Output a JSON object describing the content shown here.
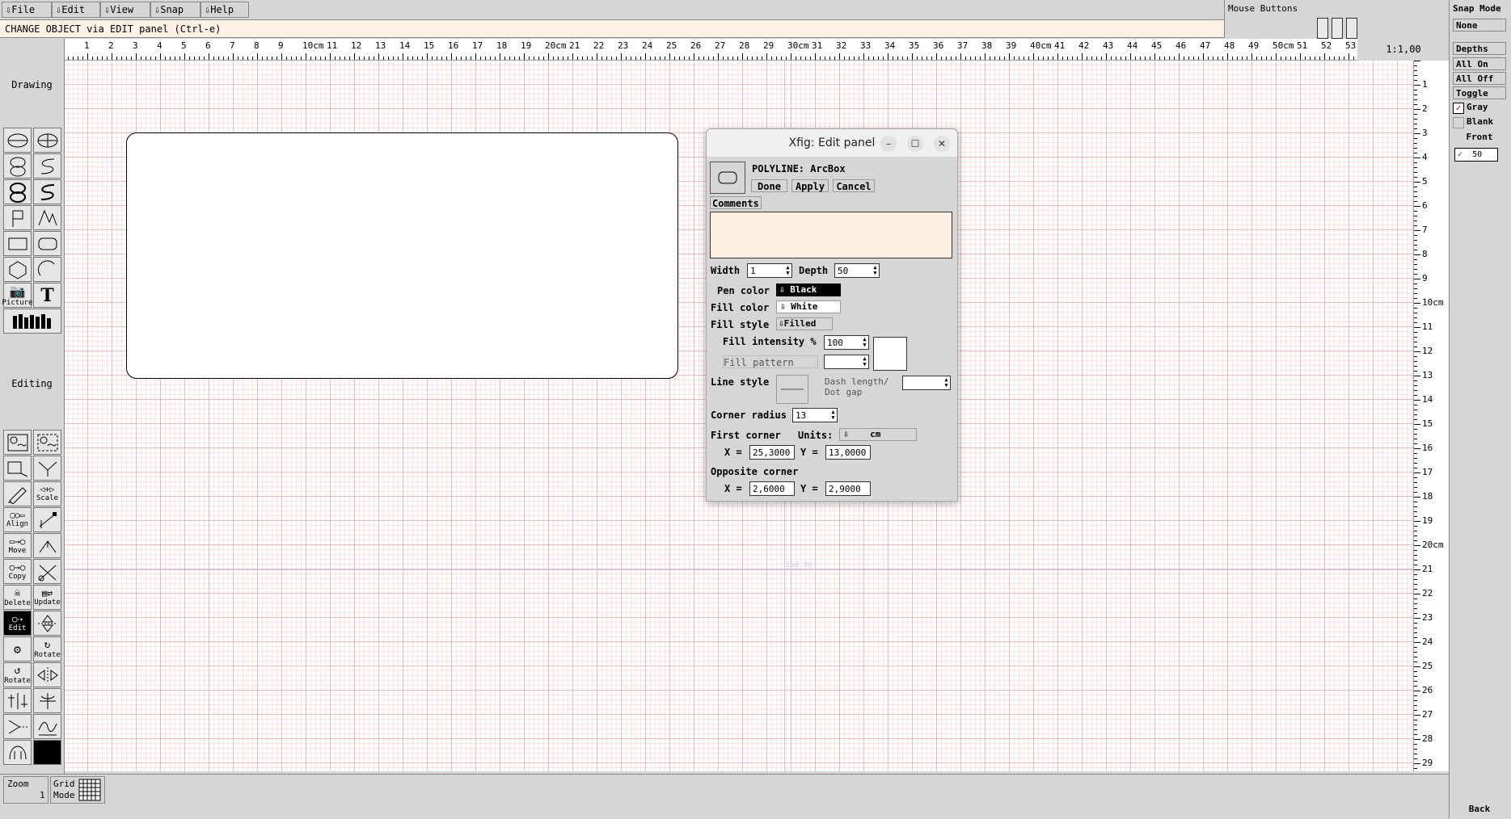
{
  "menu": [
    "File",
    "Edit",
    "View",
    "Snap",
    "Help"
  ],
  "message": "CHANGE OBJECT via EDIT panel   (Ctrl-e)",
  "mouse_buttons_label": "Mouse Buttons",
  "zoom_ratio": "1:1,00",
  "ruler": {
    "h_ticks": [
      "1",
      "2",
      "3",
      "4",
      "5",
      "6",
      "7",
      "8",
      "9",
      "10cm",
      "11",
      "12",
      "13",
      "14",
      "15",
      "16",
      "17",
      "18",
      "19",
      "20cm",
      "21",
      "22",
      "23",
      "24",
      "25",
      "26",
      "27",
      "28",
      "29",
      "30cm",
      "31",
      "32",
      "33",
      "34",
      "35",
      "36",
      "37",
      "38",
      "39",
      "40cm",
      "41",
      "42",
      "43",
      "44",
      "45",
      "46",
      "47",
      "48",
      "49",
      "50cm",
      "51",
      "52",
      "53"
    ],
    "v_ticks": [
      "1",
      "2",
      "3",
      "4",
      "5",
      "6",
      "7",
      "8",
      "9",
      "10cm",
      "11",
      "12",
      "13",
      "14",
      "15",
      "16",
      "17",
      "18",
      "19",
      "20cm",
      "21",
      "22",
      "23",
      "24",
      "25",
      "26",
      "27",
      "28",
      "29"
    ]
  },
  "left_panel": {
    "drawing_label": "Drawing",
    "editing_label": "Editing",
    "picture_label": "Picture",
    "scale_label": "Scale",
    "align_label": "Align",
    "move_label": "Move",
    "copy_label": "Copy",
    "delete_label": "Delete",
    "update_label": "Update",
    "edit_label": "Edit",
    "rotate_label": "Rotate",
    "rotate2_label": "Rotate"
  },
  "bottom": {
    "zoom_label": "Zoom",
    "zoom_value": "1",
    "grid_label": "Grid",
    "grid_label2": "Mode"
  },
  "right_panel": {
    "snap_mode_label": "Snap Mode",
    "snap_value": "None",
    "depths_label": "Depths",
    "all_on": "All On",
    "all_off": "All Off",
    "toggle": "Toggle",
    "gray": "Gray",
    "blank": "Blank",
    "front": "Front",
    "depth_value": "50",
    "back": "Back"
  },
  "canvas_watermark": "150 90",
  "dialog": {
    "title": "Xfig: Edit panel",
    "object_type": "POLYLINE: ArcBox",
    "done": "Done",
    "apply": "Apply",
    "cancel": "Cancel",
    "comments_label": "Comments",
    "comments_value": "",
    "width_label": "Width",
    "width_value": "1",
    "depth_label": "Depth",
    "depth_value": "50",
    "pen_color_label": "Pen color",
    "pen_color_value": "Black",
    "fill_color_label": "Fill color",
    "fill_color_value": "White",
    "fill_style_label": "Fill style",
    "fill_style_value": "Filled",
    "fill_intensity_label": "Fill intensity %",
    "fill_intensity_value": "100",
    "fill_pattern_label": "Fill pattern",
    "line_style_label": "Line style",
    "dash_label1": "Dash length/",
    "dash_label2": "Dot gap",
    "corner_radius_label": "Corner radius",
    "corner_radius_value": "13",
    "first_corner_label": "First corner",
    "units_label": "Units:",
    "units_value": "cm",
    "x_label": "X =",
    "y_label": "Y =",
    "first_x": "25,3000",
    "first_y": "13,0000",
    "opposite_corner_label": "Opposite corner",
    "opp_x": "2,6000",
    "opp_y": "2,9000"
  },
  "colors": {
    "canvas_grid": "#eb9696",
    "message_bg": "#fdf0e4",
    "comments_bg": "#fdeee2",
    "selected_tool": "#000000"
  }
}
